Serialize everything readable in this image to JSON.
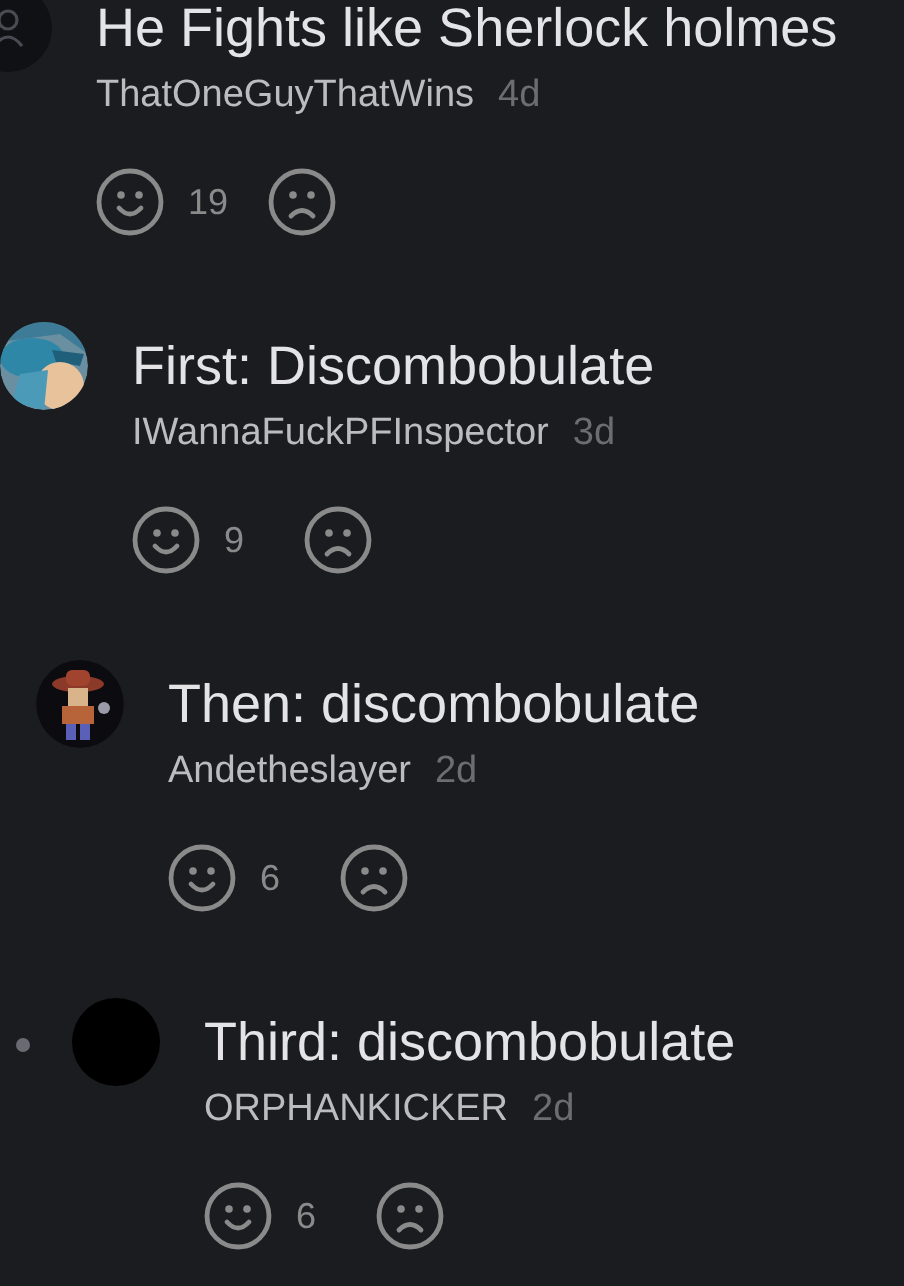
{
  "comments": [
    {
      "avatar": {
        "kind": "default"
      },
      "text": "He Fights like Sherlock holmes",
      "username": "ThatOneGuyThatWins",
      "time": "4d",
      "likes": "19",
      "replies": [
        {
          "text": "First: Discombobulate",
          "username": "IWannaFuckPFInspector",
          "time": "3d",
          "likes": "9",
          "replies": [
            {
              "text": "Then: discombobulate",
              "username": "Andetheslayer",
              "time": "2d",
              "likes": "6",
              "replies": [
                {
                  "avatar": {
                    "kind": "plain"
                  },
                  "thread_dot": true,
                  "text": "Third: discombobulate",
                  "username": "ORPHANKICKER",
                  "time": "2d",
                  "likes": "6"
                }
              ]
            }
          ]
        }
      ]
    }
  ]
}
